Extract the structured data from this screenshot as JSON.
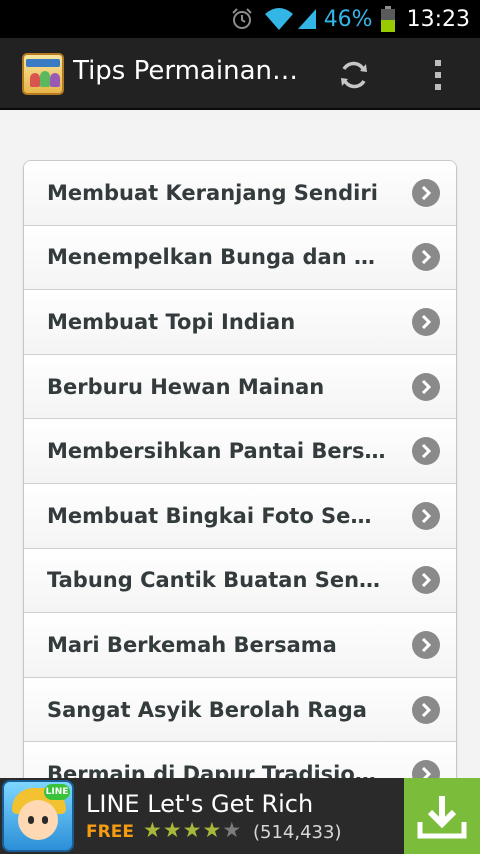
{
  "status_bar": {
    "battery_percent": "46%",
    "time": "13:23",
    "icons": [
      "alarm-icon",
      "wifi-icon",
      "signal-icon",
      "battery-icon"
    ],
    "accent_color": "#33b5e5"
  },
  "action_bar": {
    "title": "Tips Permainan…",
    "icons": [
      "app-icon",
      "refresh-icon",
      "overflow-menu-icon"
    ]
  },
  "list": {
    "items": [
      {
        "label": "Membuat Keranjang Sendiri"
      },
      {
        "label": "Menempelkan Bunga dan Ded…"
      },
      {
        "label": "Membuat Topi Indian"
      },
      {
        "label": "Berburu Hewan Mainan"
      },
      {
        "label": "Membersihkan Pantai Bersama"
      },
      {
        "label": "Membuat Bingkai Foto Sendiri"
      },
      {
        "label": "Tabung Cantik Buatan Sendiri"
      },
      {
        "label": "Mari Berkemah Bersama"
      },
      {
        "label": "Sangat Asyik Berolah Raga"
      },
      {
        "label": "Bermain di Dapur Tradisional"
      }
    ],
    "item_icon": "chevron-right-icon"
  },
  "ad": {
    "icon_badge": "LINE",
    "title": "LINE Let's Get Rich",
    "price": "FREE",
    "rating": 4.5,
    "rating_count": "(514,433)",
    "download_icon": "download-icon",
    "colors": {
      "price": "#f39c12",
      "download": "#7bbd3b",
      "stars": "#a9b83a"
    }
  }
}
